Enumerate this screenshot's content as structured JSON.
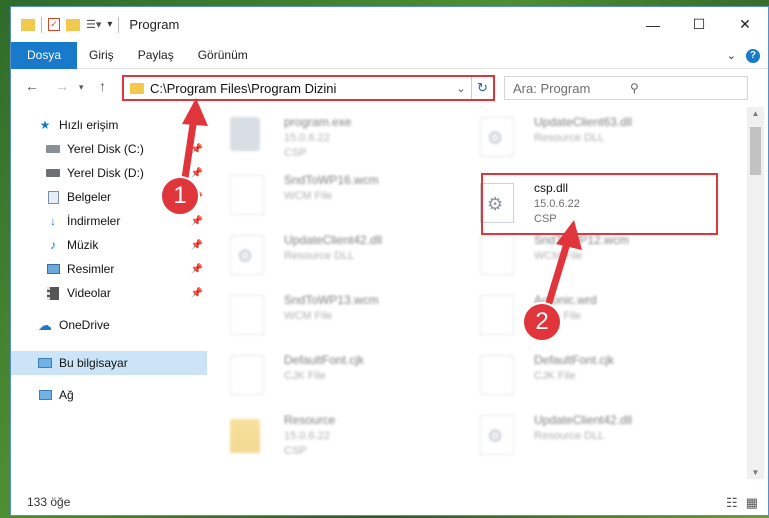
{
  "window": {
    "title": "Program"
  },
  "ribbon": {
    "tabs": [
      "Dosya",
      "Giriş",
      "Paylaş",
      "Görünüm"
    ],
    "help": "?"
  },
  "address": {
    "path": "C:\\Program Files\\Program Dizini"
  },
  "search": {
    "placeholder": "Ara: Program"
  },
  "sidebar": {
    "items": [
      {
        "label": "Hızlı erişim",
        "icon": "star-icon"
      },
      {
        "label": "Yerel Disk (C:)",
        "icon": "drive-icon"
      },
      {
        "label": "Yerel Disk (D:)",
        "icon": "drive-icon"
      },
      {
        "label": "Belgeler",
        "icon": "documents-icon"
      },
      {
        "label": "İndirmeler",
        "icon": "download-icon"
      },
      {
        "label": "Müzik",
        "icon": "music-icon"
      },
      {
        "label": "Resimler",
        "icon": "pictures-icon"
      },
      {
        "label": "Videolar",
        "icon": "video-icon"
      },
      {
        "label": "OneDrive",
        "icon": "cloud-icon"
      },
      {
        "label": "Bu bilgisayar",
        "icon": "computer-icon"
      },
      {
        "label": "Ağ",
        "icon": "network-icon"
      }
    ]
  },
  "files": [
    {
      "name": "program.exe",
      "l1": "15.0.6.22",
      "l2": "CSP",
      "type": "exe"
    },
    {
      "name": "UpdateClient63.dll",
      "l1": "Resource DLL",
      "l2": "",
      "type": "dll"
    },
    {
      "name": "SndToWP16.wcm",
      "l1": "WCM File",
      "l2": "",
      "type": "doc"
    },
    {
      "name": "csp.dll",
      "l1": "15.0.6.22",
      "l2": "CSP",
      "type": "dll"
    },
    {
      "name": "UpdateClient42.dll",
      "l1": "Resource DLL",
      "l2": "",
      "type": "dll"
    },
    {
      "name": "SndToWP12.wcm",
      "l1": "WCM File",
      "l2": "",
      "type": "doc"
    },
    {
      "name": "SndToWP13.wcm",
      "l1": "WCM File",
      "l2": "",
      "type": "doc"
    },
    {
      "name": "Acronic.wrd",
      "l1": "WRD File",
      "l2": "",
      "type": "doc"
    },
    {
      "name": "DefaultFont.cjk",
      "l1": "CJK File",
      "l2": "",
      "type": "doc"
    },
    {
      "name": "DefaultFont.cjk",
      "l1": "CJK File",
      "l2": "",
      "type": "doc"
    },
    {
      "name": "Resource",
      "l1": "15.0.6.22",
      "l2": "CSP",
      "type": "folder"
    },
    {
      "name": "UpdateClient42.dll",
      "l1": "Resource DLL",
      "l2": "",
      "type": "dll"
    }
  ],
  "status": {
    "count": "133 öğe"
  },
  "annotations": {
    "step1": "1",
    "step2": "2"
  },
  "colors": {
    "accent": "#1979ca",
    "highlight": "#e0353a",
    "selected": "#cce4f7"
  }
}
